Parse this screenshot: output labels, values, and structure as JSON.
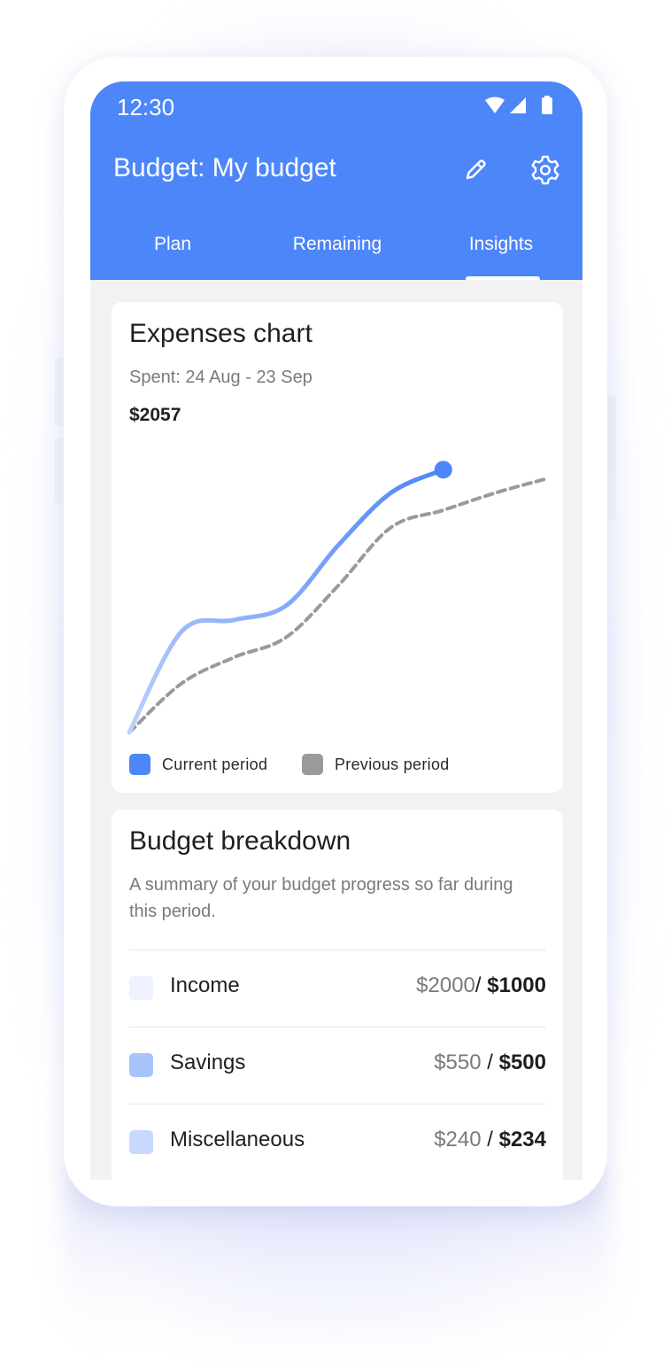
{
  "status_bar": {
    "time": "12:30",
    "icons": [
      "wifi-icon",
      "signal-icon",
      "battery-icon"
    ]
  },
  "app_bar": {
    "title": "Budget: My budget",
    "actions": [
      "edit-pencil-icon",
      "settings-gear-icon"
    ]
  },
  "tabs": [
    {
      "label": "Plan",
      "active": false
    },
    {
      "label": "Remaining",
      "active": false
    },
    {
      "label": "Insights",
      "active": true
    }
  ],
  "expenses_card": {
    "title": "Expenses chart",
    "subtitle": "Spent: 24 Aug - 23 Sep",
    "total": "$2057",
    "legend": [
      {
        "label": "Current period",
        "color": "#4d86f9"
      },
      {
        "label": "Previous period",
        "color": "#9a9a9a"
      }
    ]
  },
  "chart_data": {
    "type": "line",
    "title": "Expenses chart",
    "xlabel": "",
    "ylabel": "",
    "grid": false,
    "legend_position": "bottom",
    "x": [
      0,
      5,
      10,
      15,
      20,
      25,
      30,
      35,
      40
    ],
    "series": [
      {
        "name": "Current period",
        "color": "#4d86f9",
        "values": [
          0,
          35,
          39,
          44,
          65,
          83,
          91,
          null,
          null
        ]
      },
      {
        "name": "Previous period",
        "color": "#9a9a9a",
        "style": "dashed",
        "values": [
          0,
          17,
          26,
          33,
          51,
          71,
          77,
          83,
          88
        ]
      }
    ],
    "xlim": [
      0,
      40
    ],
    "ylim": [
      0,
      100
    ]
  },
  "breakdown_card": {
    "title": "Budget breakdown",
    "subtitle": "A summary of your budget progress so far during this period.",
    "rows": [
      {
        "label": "Income",
        "spent": "$2000",
        "separator": "/ ",
        "budget": "$1000",
        "color": "#eef3ff"
      },
      {
        "label": "Savings",
        "spent": "$550",
        "separator": " / ",
        "budget": "$500",
        "color": "#a9c3fb"
      },
      {
        "label": "Miscellaneous",
        "spent": "$240",
        "separator": " / ",
        "budget": "$234",
        "color": "#c9d9fd"
      }
    ]
  },
  "colors": {
    "primary": "#4d86f9",
    "background": "#f2f2f2",
    "card": "#ffffff"
  }
}
